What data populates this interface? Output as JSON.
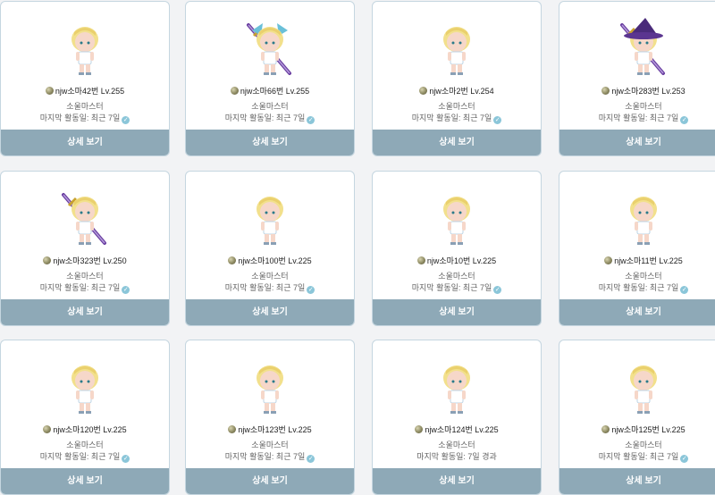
{
  "detail_button_label": "상세 보기",
  "colors": {
    "button": "#8ea9b7",
    "card_border": "#c5d6e0",
    "badge": "#8bc6d9"
  },
  "characters": [
    {
      "name": "njw소마42번",
      "level": "Lv.255",
      "job": "소울마스터",
      "last_active": "마지막 활동일: 최근 7일",
      "active_badge": true,
      "avatar": "avatar-plain"
    },
    {
      "name": "njw소마66번",
      "level": "Lv.255",
      "job": "소울마스터",
      "last_active": "마지막 활동일: 최근 7일",
      "active_badge": true,
      "avatar": "avatar-winged-sword"
    },
    {
      "name": "njw소마2번",
      "level": "Lv.254",
      "job": "소울마스터",
      "last_active": "마지막 활동일: 최근 7일",
      "active_badge": true,
      "avatar": "avatar-plain"
    },
    {
      "name": "njw소마283번",
      "level": "Lv.253",
      "job": "소울마스터",
      "last_active": "마지막 활동일: 최근 7일",
      "active_badge": true,
      "avatar": "avatar-witch-hat"
    },
    {
      "name": "njw소마323번",
      "level": "Lv.250",
      "job": "소울마스터",
      "last_active": "마지막 활동일: 최근 7일",
      "active_badge": true,
      "avatar": "avatar-sword"
    },
    {
      "name": "njw소마100번",
      "level": "Lv.225",
      "job": "소울마스터",
      "last_active": "마지막 활동일: 최근 7일",
      "active_badge": true,
      "avatar": "avatar-plain"
    },
    {
      "name": "njw소마10번",
      "level": "Lv.225",
      "job": "소울마스터",
      "last_active": "마지막 활동일: 최근 7일",
      "active_badge": true,
      "avatar": "avatar-plain"
    },
    {
      "name": "njw소마11번",
      "level": "Lv.225",
      "job": "소울마스터",
      "last_active": "마지막 활동일: 최근 7일",
      "active_badge": true,
      "avatar": "avatar-plain"
    },
    {
      "name": "njw소마120번",
      "level": "Lv.225",
      "job": "소울마스터",
      "last_active": "마지막 활동일: 최근 7일",
      "active_badge": true,
      "avatar": "avatar-plain"
    },
    {
      "name": "njw소마123번",
      "level": "Lv.225",
      "job": "소울마스터",
      "last_active": "마지막 활동일: 최근 7일",
      "active_badge": true,
      "avatar": "avatar-plain"
    },
    {
      "name": "njw소마124번",
      "level": "Lv.225",
      "job": "소울마스터",
      "last_active": "마지막 활동일: 7일 경과",
      "active_badge": false,
      "avatar": "avatar-plain"
    },
    {
      "name": "njw소마125번",
      "level": "Lv.225",
      "job": "소울마스터",
      "last_active": "마지막 활동일: 최근 7일",
      "active_badge": true,
      "avatar": "avatar-plain"
    }
  ]
}
